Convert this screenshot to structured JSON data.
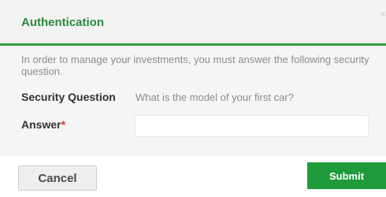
{
  "dialog": {
    "title": "Authentication",
    "close_glyph": "×",
    "intro_text": "In order to manage your investments, you must answer the following security question.",
    "security_question_label": "Security Question",
    "security_question_text": "What is the model of your first car?",
    "answer_label": "Answer",
    "answer_required_marker": "*",
    "answer_value": "",
    "cancel_label": "Cancel",
    "submit_label": "Submit"
  },
  "colors": {
    "accent_green": "#2f9e41",
    "submit_green": "#1f9a3b",
    "required_red": "#e0342f"
  },
  "icons": {
    "close": "close-icon"
  }
}
